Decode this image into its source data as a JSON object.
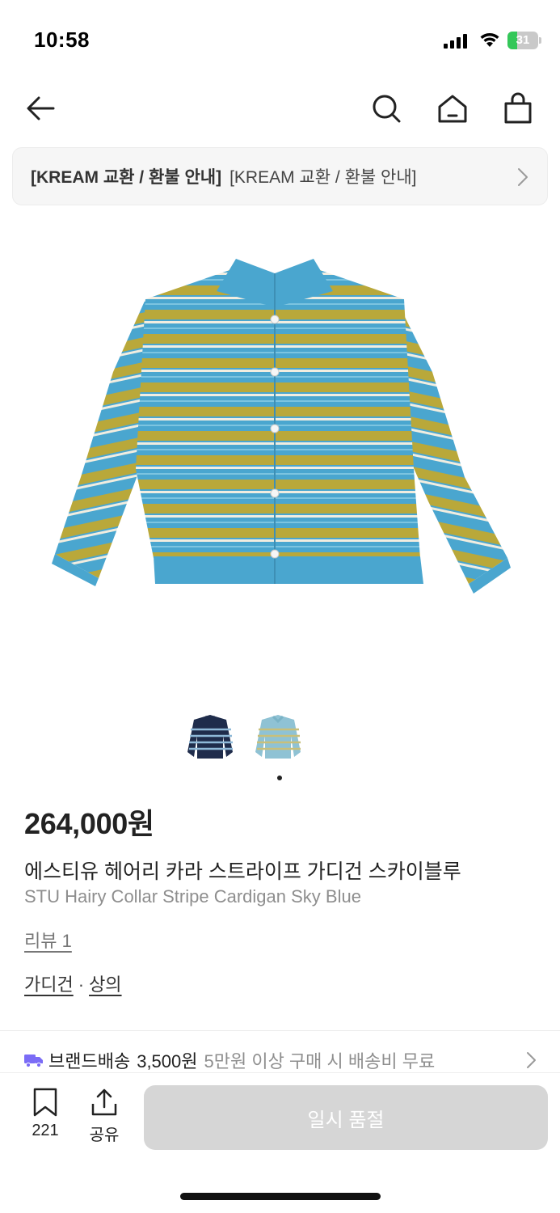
{
  "status_bar": {
    "time": "10:58",
    "battery_level": "31",
    "battery_color": "#34c759"
  },
  "nav": {
    "icons": [
      "back-arrow-icon",
      "search-icon",
      "home-icon",
      "shopping-bag-icon"
    ]
  },
  "notice": {
    "bold_text": "[KREAM 교환 / 환불 안내]",
    "text": "[KREAM 교환 / 환불 안내]"
  },
  "product": {
    "image_colors": {
      "blue": "#4aa6cf",
      "mustard": "#b9a83a",
      "cream": "#f1ede0"
    },
    "thumbnails": [
      {
        "variant": "navy-stripe",
        "colors": [
          "#1f2c4b",
          "#8fb9d8",
          "#f2f2f2"
        ]
      },
      {
        "variant": "sky-blue-stripe",
        "colors": [
          "#8fc2d4",
          "#c8bf7a",
          "#f2f0e6"
        ]
      }
    ],
    "active_slide": 1,
    "price": "264,000원",
    "name_ko": "에스티유 헤어리 카라 스트라이프 가디건 스카이블루",
    "name_en": "STU Hairy Collar Stripe Cardigan Sky Blue",
    "review_link": "리뷰 1",
    "categories": [
      "가디건",
      "상의"
    ],
    "category_separator": "·"
  },
  "delivery": {
    "label": "브랜드배송",
    "price": "3,500원",
    "note": "5만원 이상 구매 시 배송비 무료",
    "icon_color": "#7b6cf6"
  },
  "bottom_bar": {
    "bookmark_count": "221",
    "share_label": "공유",
    "action_label": "일시 품절"
  }
}
